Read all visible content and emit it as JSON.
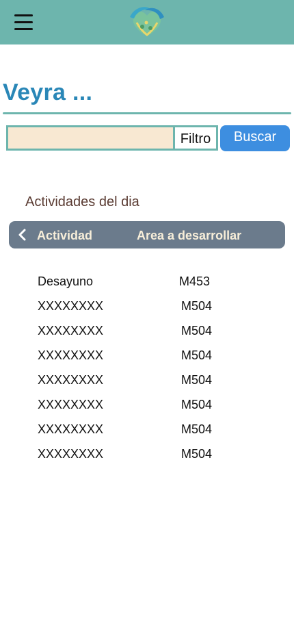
{
  "header": {
    "menu_icon": "hamburger-menu-icon",
    "logo_icon": "hands-heart-logo",
    "bar_color": "#6db5ad"
  },
  "page": {
    "title": "Veyra ..."
  },
  "search": {
    "value": "",
    "placeholder": "",
    "filter_label": "Filtro",
    "button_label": "Buscar"
  },
  "activities": {
    "section_title": "Actividades del dia",
    "back_icon": "chevron-left-icon",
    "columns": [
      "Actividad",
      "Area a desarrollar"
    ],
    "rows": [
      [
        "Desayuno",
        "M453"
      ],
      [
        "XXXXXXXX",
        "M504"
      ],
      [
        "XXXXXXXX",
        "M504"
      ],
      [
        "XXXXXXXX",
        "M504"
      ],
      [
        "XXXXXXXX",
        "M504"
      ],
      [
        "XXXXXXXX",
        "M504"
      ],
      [
        "XXXXXXXX",
        "M504"
      ],
      [
        "XXXXXXXX",
        "M504"
      ]
    ]
  },
  "colors": {
    "accent_teal": "#6db5ad",
    "title_blue": "#2a87b7",
    "button_blue": "#3d8ee0",
    "input_bg": "#f8e8d2",
    "header_gray": "#6b7b8c"
  }
}
